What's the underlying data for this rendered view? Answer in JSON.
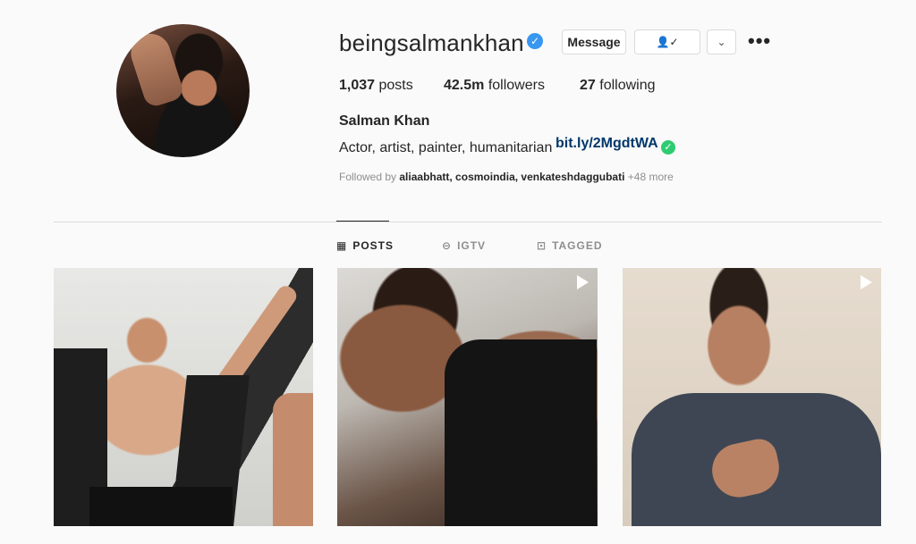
{
  "profile": {
    "username": "beingsalmankhan",
    "verified_icon": "verified-badge-icon",
    "full_name": "Salman Khan",
    "bio": "Actor, artist, painter, humanitarian",
    "link": "bit.ly/2MgdtWA",
    "stats": {
      "posts_count": "1,037",
      "posts_label": " posts",
      "followers_count": "42.5m",
      "followers_label": " followers",
      "following_count": "27",
      "following_label": " following"
    },
    "followed_by": {
      "prefix": "Followed by ",
      "names": "aliaabhatt, cosmoindia, venkateshdaggubati",
      "more": " +48 more"
    }
  },
  "actions": {
    "message_label": "Message",
    "follow_icon": "person-check-icon",
    "dropdown_icon": "chevron-down-icon",
    "more_label": "•••"
  },
  "tabs": [
    {
      "label": "POSTS",
      "icon": "grid-icon",
      "active": true
    },
    {
      "label": "IGTV",
      "icon": "igtv-icon",
      "active": false
    },
    {
      "label": "TAGGED",
      "icon": "tagged-icon",
      "active": false
    }
  ],
  "posts": [
    {
      "type": "photo"
    },
    {
      "type": "video"
    },
    {
      "type": "video"
    }
  ],
  "colors": {
    "background": "#fafafa",
    "verified": "#3897f0",
    "link": "#00376b",
    "check": "#2ecc71"
  }
}
